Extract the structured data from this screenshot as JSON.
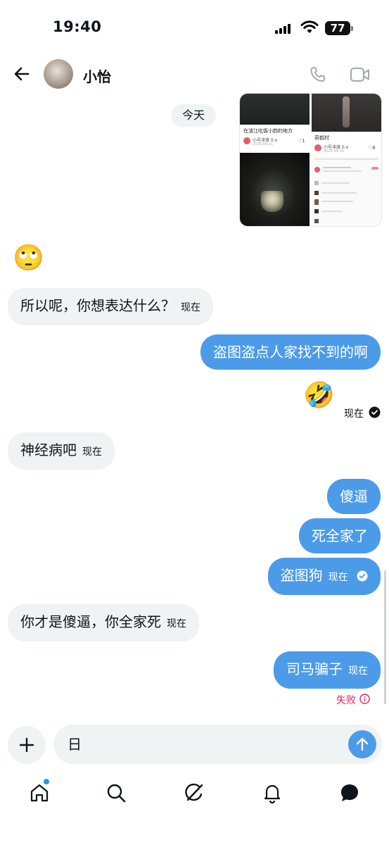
{
  "status_bar": {
    "time": "19:40",
    "battery": "77"
  },
  "header": {
    "contact_name": "小怡"
  },
  "date_chip": "今天",
  "shared_post": {
    "left_caption": "在滨江吃饭小韵的地方",
    "left_user": "小号冲浪 0.o",
    "left_date": "2025-09-11",
    "left_likes": "1",
    "right_caption": "奇鹤村",
    "right_user": "小号冲浪 0.o",
    "right_date": "2025-09-16",
    "right_likes": "8"
  },
  "messages": [
    {
      "text": "🙄"
    },
    {
      "text": "所以呢，你想表达什么？",
      "time": "现在"
    },
    {
      "text": "盗图盗点人家找不到的啊"
    },
    {
      "text": "🤣",
      "time": "现在"
    },
    {
      "text": "神经病吧",
      "time": "现在"
    },
    {
      "text": "傻逼"
    },
    {
      "text": "死全家了"
    },
    {
      "text": "盗图狗",
      "time": "现在"
    },
    {
      "text": "你才是傻逼，你全家死",
      "time": "现在"
    },
    {
      "text": "司马骗子",
      "time": "现在",
      "status": "失败"
    }
  ],
  "composer": {
    "value": "日"
  },
  "colors": {
    "accent": "#4c9be8",
    "incoming": "#eff3f4",
    "error": "#e0245e"
  },
  "icons": [
    "back-arrow-icon",
    "phone-icon",
    "video-icon",
    "plus-icon",
    "send-arrow-icon",
    "home-icon",
    "search-icon",
    "grok-icon",
    "bell-icon",
    "messages-icon"
  ]
}
